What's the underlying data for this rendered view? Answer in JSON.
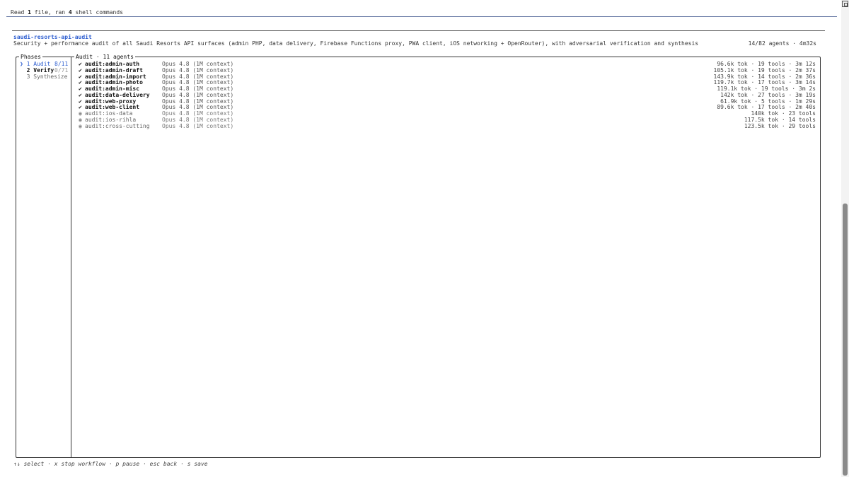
{
  "status_line": {
    "prefix": "Read ",
    "files": "1",
    "mid": " file, ran ",
    "cmds": "4",
    "suffix": " shell commands"
  },
  "workflow": {
    "name": "saudi-resorts-api-audit",
    "description": "Security + performance audit of all Saudi Resorts API surfaces (admin PHP, data delivery, Firebase Functions proxy, PWA client, iOS networking + OpenRouter), with adversarial verification and synthesis",
    "stats": "14/82 agents · 4m32s"
  },
  "phases_panel": {
    "title": "Phases",
    "items": [
      {
        "label": "❯ 1 Audit",
        "count": "8/11"
      },
      {
        "label": "  2 Verify",
        "count": "0/71"
      },
      {
        "label": "  3 Synthesize",
        "count": ""
      }
    ]
  },
  "audit_panel": {
    "title": "Audit · 11 agents",
    "agents": [
      {
        "mark": "✔",
        "name": "audit:admin-auth",
        "model": "Opus 4.8 (1M context)",
        "meta": "96.6k tok · 19 tools · 3m 12s"
      },
      {
        "mark": "✔",
        "name": "audit:admin-draft",
        "model": "Opus 4.8 (1M context)",
        "meta": "105.1k tok · 19 tools · 2m 37s"
      },
      {
        "mark": "✔",
        "name": "audit:admin-import",
        "model": "Opus 4.8 (1M context)",
        "meta": "143.9k tok · 14 tools · 2m 36s"
      },
      {
        "mark": "✔",
        "name": "audit:admin-photo",
        "model": "Opus 4.8 (1M context)",
        "meta": "119.7k tok · 17 tools · 3m 14s"
      },
      {
        "mark": "✔",
        "name": "audit:admin-misc",
        "model": "Opus 4.8 (1M context)",
        "meta": "119.1k tok · 19 tools · 3m 2s"
      },
      {
        "mark": "✔",
        "name": "audit:data-delivery",
        "model": "Opus 4.8 (1M context)",
        "meta": "142k tok · 27 tools · 3m 19s"
      },
      {
        "mark": "✔",
        "name": "audit:web-proxy",
        "model": "Opus 4.8 (1M context)",
        "meta": "61.9k tok · 5 tools · 1m 29s"
      },
      {
        "mark": "✔",
        "name": "audit:web-client",
        "model": "Opus 4.8 (1M context)",
        "meta": "89.6k tok · 17 tools · 2m 40s"
      },
      {
        "mark": "◉",
        "name": "audit:ios-data",
        "model": "Opus 4.8 (1M context)",
        "meta": "140k tok · 23 tools"
      },
      {
        "mark": "◉",
        "name": "audit:ios-rihla",
        "model": "Opus 4.8 (1M context)",
        "meta": "117.5k tok · 14 tools"
      },
      {
        "mark": "◉",
        "name": "audit:cross-cutting",
        "model": "Opus 4.8 (1M context)",
        "meta": "123.5k tok · 29 tools"
      }
    ]
  },
  "footer": "↑↓ select · x stop workflow · p pause · esc back · s save",
  "colors": {
    "accent": "#2f5fd0",
    "border": "#333333"
  }
}
